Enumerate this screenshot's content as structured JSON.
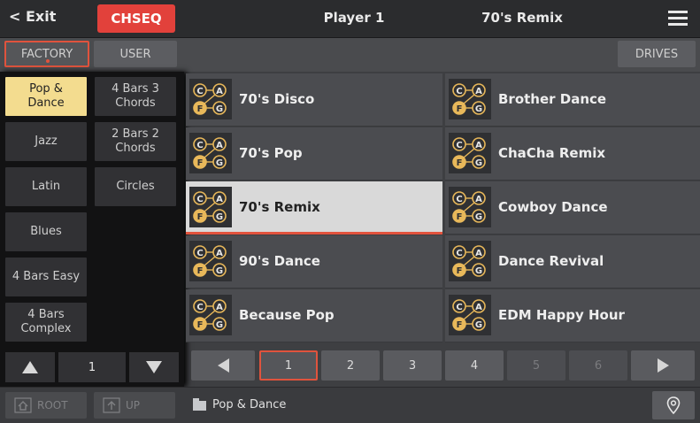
{
  "header": {
    "exit_label": "< Exit",
    "mode_label": "CHSEQ",
    "player_label": "Player 1",
    "song_label": "70's Remix"
  },
  "tabs": {
    "factory_label": "FACTORY",
    "user_label": "USER",
    "drives_label": "DRIVES"
  },
  "categories": [
    {
      "label": "Pop &\nDance",
      "selected": true
    },
    {
      "label": "4 Bars 3\nChords"
    },
    {
      "label": "Jazz"
    },
    {
      "label": "2 Bars 2\nChords"
    },
    {
      "label": "Latin"
    },
    {
      "label": "Circles"
    },
    {
      "label": "Blues"
    },
    {
      "label": "4 Bars Easy"
    },
    {
      "label": "4 Bars\nComplex"
    }
  ],
  "category_page": "1",
  "items": [
    {
      "label": "70's Disco"
    },
    {
      "label": "Brother Dance"
    },
    {
      "label": "70's Pop"
    },
    {
      "label": "ChaCha Remix"
    },
    {
      "label": "70's Remix",
      "selected": true
    },
    {
      "label": "Cowboy Dance"
    },
    {
      "label": "90's Dance"
    },
    {
      "label": "Dance Revival"
    },
    {
      "label": "Because Pop"
    },
    {
      "label": "EDM Happy Hour"
    }
  ],
  "chord_icon_letters": [
    "C",
    "A",
    "F",
    "G"
  ],
  "pages": [
    "1",
    "2",
    "3",
    "4",
    "5",
    "6"
  ],
  "current_page": "1",
  "footer": {
    "root_label": "ROOT",
    "up_label": "UP",
    "path_label": "Pop & Dance"
  },
  "colors": {
    "accent": "#e2413b",
    "selected_category": "#f3dc8f",
    "selected_item": "#d9d9d9"
  }
}
